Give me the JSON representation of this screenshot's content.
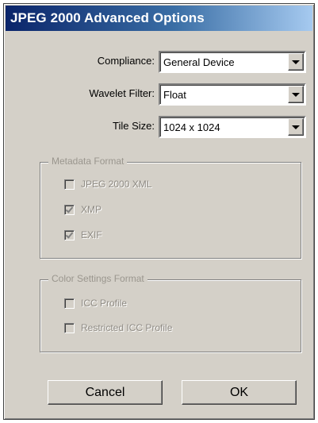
{
  "window": {
    "title": "JPEG 2000 Advanced Options"
  },
  "fields": [
    {
      "label": "Compliance:",
      "value": "General Device"
    },
    {
      "label": "Wavelet Filter:",
      "value": "Float"
    },
    {
      "label": "Tile Size:",
      "value": "1024 x 1024"
    }
  ],
  "metadata_group": {
    "title": "Metadata Format",
    "items": [
      {
        "label": "JPEG 2000 XML",
        "checked": false
      },
      {
        "label": "XMP",
        "checked": true
      },
      {
        "label": "EXIF",
        "checked": true
      }
    ]
  },
  "color_group": {
    "title": "Color Settings Format",
    "items": [
      {
        "label": "ICC Profile",
        "checked": false
      },
      {
        "label": "Restricted ICC Profile",
        "checked": false
      }
    ]
  },
  "buttons": {
    "cancel": "Cancel",
    "ok": "OK"
  },
  "colors": {
    "title_bar_start": "#0a246a",
    "title_bar_end": "#a6caf0",
    "dialog_bg": "#d4d0c8",
    "disabled_text": "#8f8b84"
  }
}
